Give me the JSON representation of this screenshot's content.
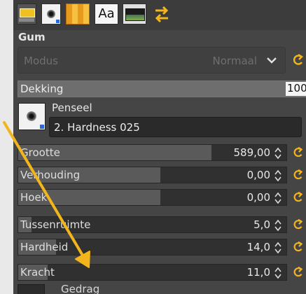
{
  "tabs": [
    {
      "name": "tool-options-tab"
    },
    {
      "name": "brushes-tab"
    },
    {
      "name": "patterns-tab"
    },
    {
      "name": "fonts-tab",
      "label": "Aa"
    },
    {
      "name": "images-tab"
    },
    {
      "name": "undo-history-tab"
    }
  ],
  "tool_title": "Gum",
  "mode": {
    "label": "Modus",
    "value": "Normaal"
  },
  "opacity": {
    "label": "Dekking",
    "value": "100",
    "level": 1.0
  },
  "brush": {
    "heading": "Penseel",
    "name": "2. Hardness 025"
  },
  "sliders": [
    {
      "label": "Grootte",
      "value": "589,00",
      "level": 0.72
    },
    {
      "label": "Verhouding",
      "value": "0,00",
      "level": 0.53
    },
    {
      "label": "Hoek",
      "value": "0,00",
      "level": 0.53
    },
    {
      "label": "Tussenruimte",
      "value": "5,0",
      "level": 0.05
    },
    {
      "label": "Hardheid",
      "value": "14,0",
      "level": 0.14
    },
    {
      "label": "Kracht",
      "value": "11,0",
      "level": 0.11
    }
  ],
  "behavior": {
    "label": "Gedrag"
  },
  "colors": {
    "accent": "#f3b51c",
    "panel": "#454545",
    "slider_fill": "#5a5a5a"
  }
}
